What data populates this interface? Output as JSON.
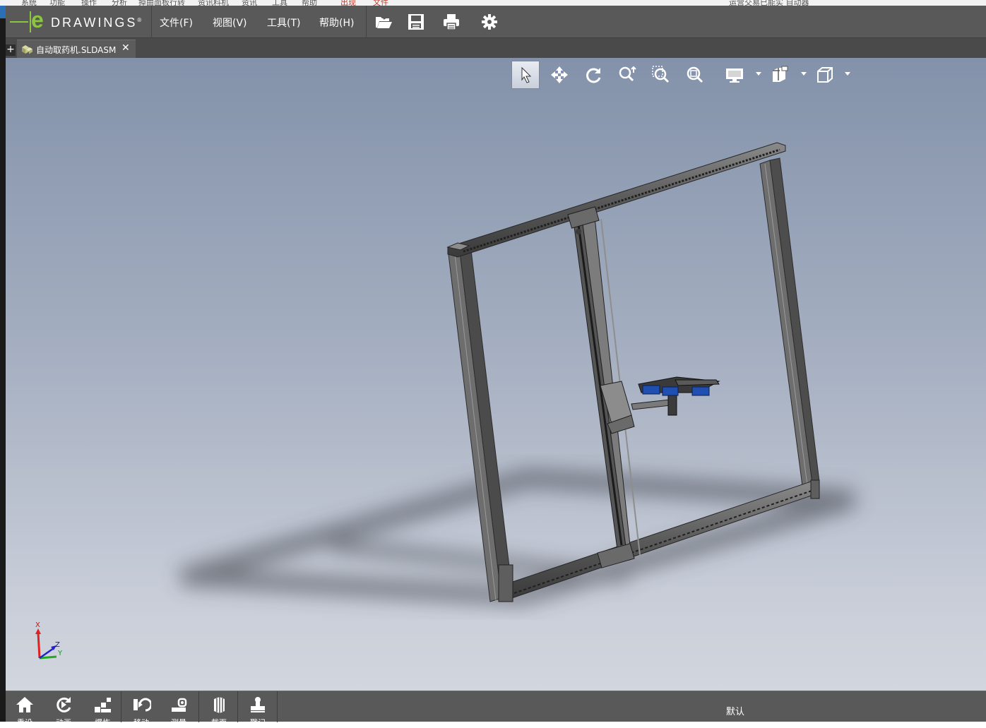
{
  "app": {
    "brand_e": "e",
    "brand_word": "DRAWINGS",
    "brand_reg": "®"
  },
  "menu": {
    "items": [
      {
        "label": "文件(F)"
      },
      {
        "label": "视图(V)"
      },
      {
        "label": "工具(T)"
      },
      {
        "label": "帮助(H)"
      }
    ],
    "tools": [
      {
        "icon": "open-folder-icon"
      },
      {
        "icon": "save-icon"
      },
      {
        "icon": "print-icon"
      },
      {
        "icon": "gear-icon"
      }
    ]
  },
  "tabs": {
    "add_label": "+",
    "document": {
      "label": "自动取药机.SLDASM",
      "close": "✕",
      "icon": "assembly-icon"
    }
  },
  "view_toolbar": {
    "buttons": [
      {
        "icon": "select-arrow-icon",
        "active": true
      },
      {
        "icon": "pan-icon"
      },
      {
        "icon": "rotate-icon"
      },
      {
        "icon": "zoom-icon"
      },
      {
        "icon": "zoom-to-area-icon"
      },
      {
        "icon": "zoom-to-fit-icon"
      },
      {
        "icon": "display-style-icon",
        "dropdown": true
      },
      {
        "icon": "appearance-icon",
        "dropdown": true
      },
      {
        "icon": "standard-views-icon",
        "dropdown": true
      }
    ]
  },
  "triad": {
    "x": "X",
    "y": "Y",
    "z": "Z"
  },
  "bottom_toolbar": {
    "buttons": [
      {
        "icon": "home-icon",
        "label": "重设"
      },
      {
        "icon": "animate-icon",
        "label": "动画"
      },
      {
        "icon": "explode-icon",
        "label": "爆炸"
      },
      {
        "icon": "move-icon",
        "label": "移动"
      },
      {
        "icon": "measure-icon",
        "label": "测量"
      },
      {
        "icon": "section-icon",
        "label": "截面"
      },
      {
        "icon": "markup-icon",
        "label": "戳记"
      }
    ],
    "configuration": "默认"
  },
  "background_window": {
    "texts": [
      "系统",
      "功能",
      "操作",
      "分析",
      "掉曲面板行转",
      "资讯料机",
      "资讯",
      "工具",
      "帮助",
      "出现",
      "文件",
      "运营交易已能实 自动器"
    ]
  },
  "colors": {
    "menubar": "#595959",
    "accent_green": "#8cc63f",
    "viewport_top": "#8392aa",
    "viewport_bottom": "#d2d6de",
    "gripper_blue": "#1f4fb0"
  }
}
